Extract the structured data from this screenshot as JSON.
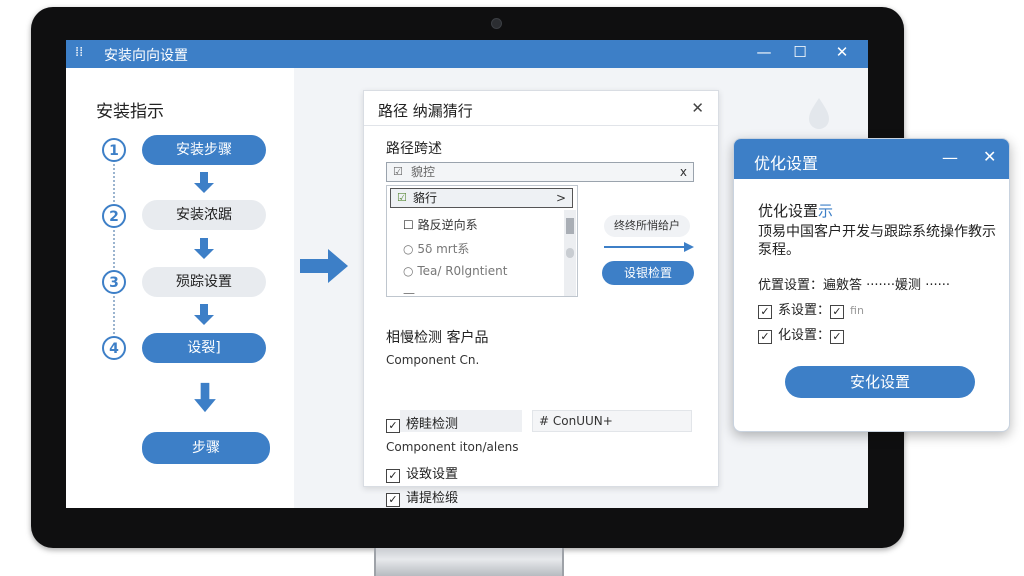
{
  "window": {
    "title": "安装向向设置",
    "app_icon": "grid-dots-icon",
    "controls": {
      "minimize": "—",
      "maximize": "☐",
      "close": "✕"
    }
  },
  "guide": {
    "title": "安装指示",
    "steps": [
      {
        "number": "1",
        "label": "安装步骤",
        "style": "primary"
      },
      {
        "number": "2",
        "label": "安装浓踞",
        "style": "grey"
      },
      {
        "number": "3",
        "label": "殒踪设置",
        "style": "grey"
      },
      {
        "number": "4",
        "label": "设裂]",
        "style": "primary"
      }
    ],
    "final_button": "步骤"
  },
  "path_dialog": {
    "title": "路径 纳漏猜行",
    "close": "✕",
    "section_label": "路径跨述",
    "combo": {
      "check": "☑",
      "value": "貌控",
      "clear": "x"
    },
    "tree": {
      "selected": {
        "check": "☑",
        "label": "貉行",
        "chevron": ">"
      },
      "items": [
        {
          "marker": "☐",
          "label": "路反逆向系"
        },
        {
          "marker": "○",
          "label": "5δ mrt系"
        },
        {
          "marker": "○",
          "label": "Tea/ R0lgntient"
        },
        {
          "marker": "—",
          "label": ""
        }
      ]
    },
    "side_label": "终终所悄给户",
    "side_button": "设银检置",
    "section2_label": "相慢检测 客户品",
    "component1_label": "Component Cn.",
    "check_items": [
      {
        "checked": "✓",
        "label": "榜眭检测"
      }
    ],
    "field_value": "# ConUUN+",
    "component2_label": "Component iton/alens",
    "check_items2": [
      {
        "checked": "✓",
        "label": "设致设置"
      },
      {
        "checked": "✓",
        "label": "请提检缎"
      }
    ]
  },
  "optimize_dialog": {
    "title": "优化设置",
    "minimize": "—",
    "close": "✕",
    "heading_main": "优化设置",
    "heading_accent": "示",
    "description": "顶易中国客户开发与跟踪系统操作教示泵程。",
    "setting_row": "优置设置：遍敫答 ·······媛测 ······",
    "rows": [
      {
        "checked": "✓",
        "label": "系设置：",
        "trailing_check": "✓",
        "trailing_text": "fin"
      },
      {
        "checked": "✓",
        "label": "化设置：",
        "trailing_check": "✓",
        "trailing_text": ""
      }
    ],
    "button": "安化设置"
  },
  "colors": {
    "accent": "#3d7fc7",
    "bezel": "#0f0f10",
    "screen_bg": "#f2f4f7"
  }
}
